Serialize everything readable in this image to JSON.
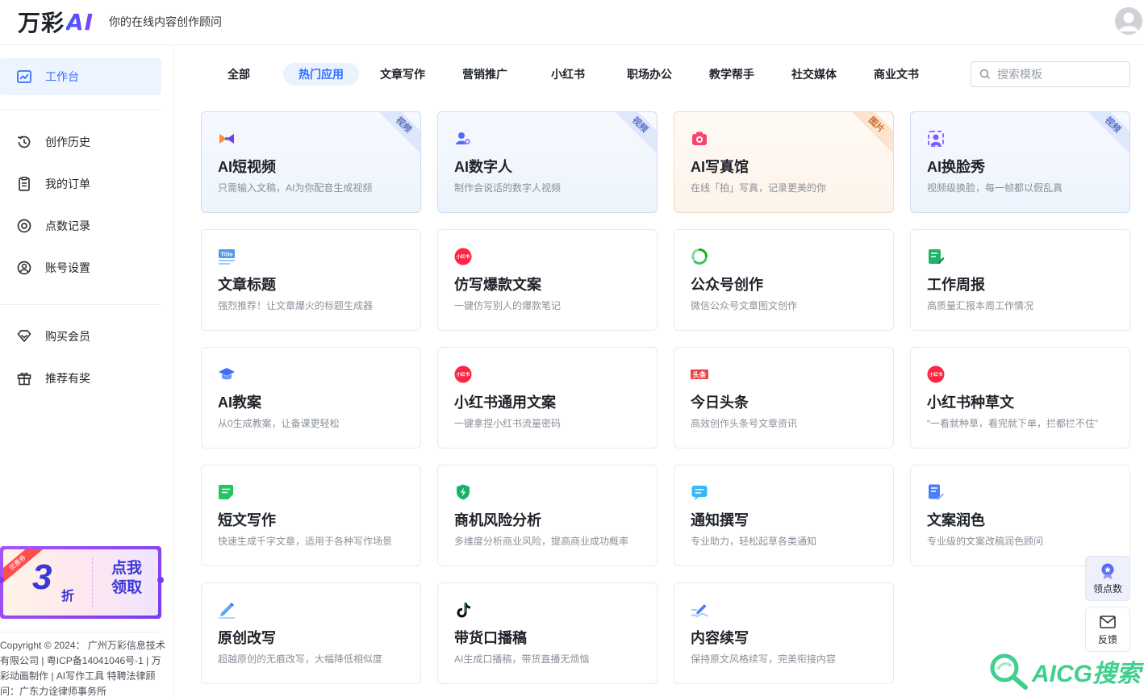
{
  "header": {
    "logo_text": "万彩",
    "logo_ai": "AI",
    "tagline": "你的在线内容创作顾问"
  },
  "sidebar": {
    "items": [
      {
        "label": "工作台",
        "icon": "chart-icon"
      },
      {
        "label": "创作历史",
        "icon": "history-icon"
      },
      {
        "label": "我的订单",
        "icon": "order-icon"
      },
      {
        "label": "点数记录",
        "icon": "points-icon"
      },
      {
        "label": "账号设置",
        "icon": "account-icon"
      },
      {
        "label": "购买会员",
        "icon": "diamond-icon"
      },
      {
        "label": "推荐有奖",
        "icon": "gift-icon"
      }
    ],
    "promo": {
      "ribbon": "优惠券",
      "number": "3",
      "unit": "折",
      "action": "点我领取"
    },
    "footer": "Copyright © 2024： 广州万彩信息技术有限公司 | 粤ICP备14041046号-1 | 万彩动画制作 | AI写作工具 特聘法律顾问：广东力诠律师事务所"
  },
  "tabs": [
    {
      "label": "全部"
    },
    {
      "label": "热门应用"
    },
    {
      "label": "文章写作"
    },
    {
      "label": "营销推广"
    },
    {
      "label": "小红书"
    },
    {
      "label": "职场办公"
    },
    {
      "label": "教学帮手"
    },
    {
      "label": "社交媒体"
    },
    {
      "label": "商业文书"
    }
  ],
  "search": {
    "placeholder": "搜索模板"
  },
  "cards": [
    {
      "title": "AI短视频",
      "desc": "只需输入文稿，AI为你配音生成视频",
      "tag": "视频",
      "icon": "video-bowtie-icon"
    },
    {
      "title": "AI数字人",
      "desc": "制作会说话的数字人视频",
      "tag": "视频",
      "icon": "digital-human-icon"
    },
    {
      "title": "AI写真馆",
      "desc": "在线「拍」写真，记录更美的你",
      "tag": "图片",
      "icon": "camera-icon"
    },
    {
      "title": "AI换脸秀",
      "desc": "视频级换脸，每一帧都以假乱真",
      "tag": "视频",
      "icon": "face-swap-icon"
    },
    {
      "title": "文章标题",
      "desc": "强烈推荐！让文章爆火的标题生成器",
      "tag": "",
      "icon": "title-icon"
    },
    {
      "title": "仿写爆款文案",
      "desc": "一键仿写别人的爆款笔记",
      "tag": "",
      "icon": "xiaohongshu-icon"
    },
    {
      "title": "公众号创作",
      "desc": "微信公众号文章图文创作",
      "tag": "",
      "icon": "wechat-official-icon"
    },
    {
      "title": "工作周报",
      "desc": "高质量汇报本周工作情况",
      "tag": "",
      "icon": "report-icon"
    },
    {
      "title": "AI教案",
      "desc": "从0生成教案，让备课更轻松",
      "tag": "",
      "icon": "graduation-cap-icon"
    },
    {
      "title": "小红书通用文案",
      "desc": "一键拿捏小红书流量密码",
      "tag": "",
      "icon": "xiaohongshu-icon"
    },
    {
      "title": "今日头条",
      "desc": "高效创作头条号文章资讯",
      "tag": "",
      "icon": "toutiao-icon"
    },
    {
      "title": "小红书种草文",
      "desc": "“一看就种草，看完就下单，拦都拦不住”",
      "tag": "",
      "icon": "xiaohongshu-icon"
    },
    {
      "title": "短文写作",
      "desc": "快速生成千字文章，适用于各种写作场景",
      "tag": "",
      "icon": "short-doc-icon"
    },
    {
      "title": "商机风险分析",
      "desc": "多维度分析商业风险，提高商业成功概率",
      "tag": "",
      "icon": "shield-bolt-icon"
    },
    {
      "title": "通知撰写",
      "desc": "专业助力，轻松起草各类通知",
      "tag": "",
      "icon": "notice-icon"
    },
    {
      "title": "文案润色",
      "desc": "专业级的文案改稿润色顾问",
      "tag": "",
      "icon": "polish-icon"
    },
    {
      "title": "原创改写",
      "desc": "超越原创的无痕改写，大幅降低相似度",
      "tag": "",
      "icon": "rewrite-icon"
    },
    {
      "title": "带货口播稿",
      "desc": "AI生成口播稿，带货直播无烦恼",
      "tag": "",
      "icon": "tiktok-icon"
    },
    {
      "title": "内容续写",
      "desc": "保持原文风格续写，完美衔接内容",
      "tag": "",
      "icon": "continue-write-icon"
    }
  ],
  "icon_labels": {
    "title_badge": "Title",
    "xhs_badge": "小红书",
    "toutiao_badge": "头条"
  },
  "float": {
    "points": "领点数",
    "feedback": "反馈"
  },
  "watermark": "AICG搜索",
  "colors": {
    "accent": "#3370ff",
    "active_bg": "#eef4ff",
    "promo_purple": "#7c3aed"
  }
}
